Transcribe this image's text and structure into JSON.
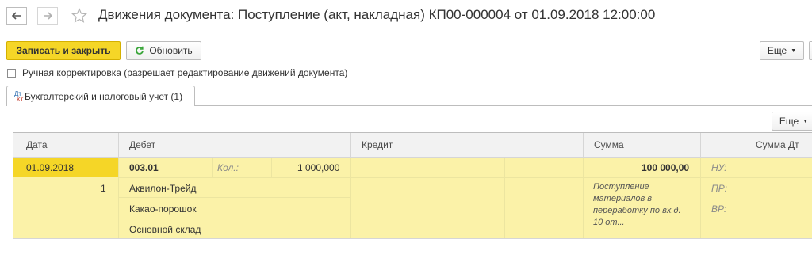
{
  "window": {
    "title": "Движения документа: Поступление (акт, накладная) КП00-000004 от 01.09.2018 12:00:00"
  },
  "toolbar": {
    "save_close": "Записать и закрыть",
    "refresh": "Обновить",
    "more": "Еще"
  },
  "manual_edit": {
    "label": "Ручная корректировка (разрешает редактирование движений документа)",
    "checked": false
  },
  "tabs": [
    {
      "icon_top": "Дт",
      "icon_bottom": "Кт",
      "label": "Бухгалтерский и налоговый учет (1)"
    }
  ],
  "grid": {
    "more": "Еще",
    "columns": {
      "date": "Дата",
      "debit": "Дебет",
      "credit": "Кредит",
      "sum": "Сумма",
      "sum_dt": "Сумма Дт"
    },
    "row": {
      "date": "01.09.2018",
      "line_no": "1",
      "debit_account": "003.01",
      "qty_label": "Кол.:",
      "qty": "1 000,000",
      "debit_subconto": [
        "Аквилон-Трейд",
        "Какао-порошок",
        "Основной склад"
      ],
      "sum": "100 000,00",
      "comment": "Поступление материалов в переработку по вх.д. 10 от...",
      "tax_labels": [
        "НУ:",
        "ПР:",
        "ВР:"
      ]
    }
  },
  "colors": {
    "accent": "#f5d627",
    "row_fill": "#fbf2a8",
    "header_fill": "#f2f2f2",
    "refresh_icon": "#3aa63a"
  },
  "icons": [
    "arrow-left-icon",
    "arrow-right-icon",
    "star-icon",
    "refresh-icon",
    "dropdown-arrow-icon",
    "dt-kt-icon"
  ]
}
